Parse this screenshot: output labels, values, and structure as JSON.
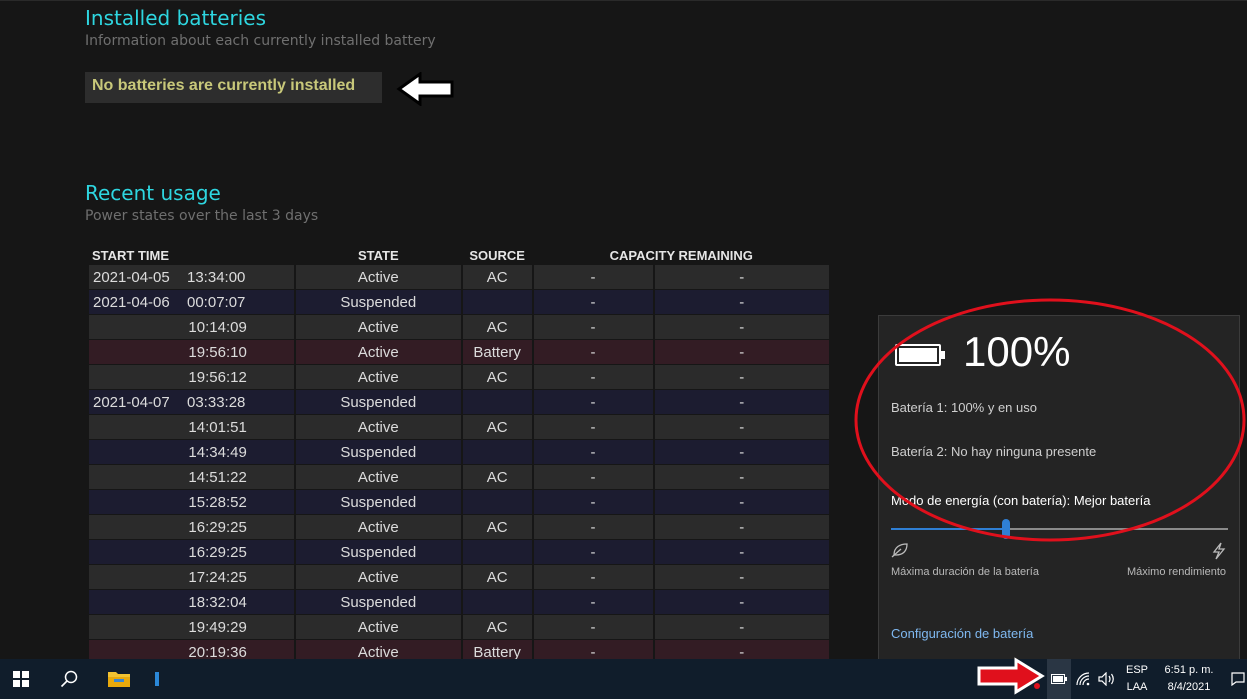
{
  "report": {
    "installed": {
      "title": "Installed batteries",
      "subtitle": "Information about each currently installed battery",
      "notice": "No batteries are currently installed"
    },
    "usage": {
      "title": "Recent usage",
      "subtitle": "Power states over the last 3 days",
      "columns": [
        "START TIME",
        "STATE",
        "SOURCE",
        "CAPACITY REMAINING"
      ],
      "rows": [
        {
          "date": "2021-04-05",
          "time": "13:34:00",
          "state": "Active",
          "source": "AC",
          "cap1": "-",
          "cap2": "-",
          "kind": "active"
        },
        {
          "date": "2021-04-06",
          "time": "00:07:07",
          "state": "Suspended",
          "source": "",
          "cap1": "-",
          "cap2": "-",
          "kind": "susp"
        },
        {
          "date": "",
          "time": "10:14:09",
          "state": "Active",
          "source": "AC",
          "cap1": "-",
          "cap2": "-",
          "kind": "active"
        },
        {
          "date": "",
          "time": "19:56:10",
          "state": "Active",
          "source": "Battery",
          "cap1": "-",
          "cap2": "-",
          "kind": "batt"
        },
        {
          "date": "",
          "time": "19:56:12",
          "state": "Active",
          "source": "AC",
          "cap1": "-",
          "cap2": "-",
          "kind": "active"
        },
        {
          "date": "2021-04-07",
          "time": "03:33:28",
          "state": "Suspended",
          "source": "",
          "cap1": "-",
          "cap2": "-",
          "kind": "susp"
        },
        {
          "date": "",
          "time": "14:01:51",
          "state": "Active",
          "source": "AC",
          "cap1": "-",
          "cap2": "-",
          "kind": "active"
        },
        {
          "date": "",
          "time": "14:34:49",
          "state": "Suspended",
          "source": "",
          "cap1": "-",
          "cap2": "-",
          "kind": "susp"
        },
        {
          "date": "",
          "time": "14:51:22",
          "state": "Active",
          "source": "AC",
          "cap1": "-",
          "cap2": "-",
          "kind": "active"
        },
        {
          "date": "",
          "time": "15:28:52",
          "state": "Suspended",
          "source": "",
          "cap1": "-",
          "cap2": "-",
          "kind": "susp"
        },
        {
          "date": "",
          "time": "16:29:25",
          "state": "Active",
          "source": "AC",
          "cap1": "-",
          "cap2": "-",
          "kind": "active"
        },
        {
          "date": "",
          "time": "16:29:25",
          "state": "Suspended",
          "source": "",
          "cap1": "-",
          "cap2": "-",
          "kind": "susp"
        },
        {
          "date": "",
          "time": "17:24:25",
          "state": "Active",
          "source": "AC",
          "cap1": "-",
          "cap2": "-",
          "kind": "active"
        },
        {
          "date": "",
          "time": "18:32:04",
          "state": "Suspended",
          "source": "",
          "cap1": "-",
          "cap2": "-",
          "kind": "susp"
        },
        {
          "date": "",
          "time": "19:49:29",
          "state": "Active",
          "source": "AC",
          "cap1": "-",
          "cap2": "-",
          "kind": "active"
        },
        {
          "date": "",
          "time": "20:19:36",
          "state": "Active",
          "source": "Battery",
          "cap1": "-",
          "cap2": "-",
          "kind": "batt"
        }
      ]
    }
  },
  "flyout": {
    "percent": "100%",
    "battery1": "Batería 1: 100% y en uso",
    "battery2": "Batería 2: No hay ninguna presente",
    "mode": "Modo de energía (con batería): Mejor batería",
    "slider_level": 0.34,
    "slider_left_label": "Máxima duración de la batería",
    "slider_right_label": "Máximo rendimiento",
    "link": "Configuración de batería"
  },
  "taskbar": {
    "language": "ESP",
    "layout": "LAA",
    "time": "6:51 p. m.",
    "date": "8/4/2021"
  },
  "colors": {
    "accent_heading": "#2ed6e0",
    "notice_text": "#c8c87a",
    "annotation": "#e0101c",
    "slider": "#2f7fd4",
    "taskbar": "#101d2b"
  },
  "icons": [
    "start-icon",
    "search-icon",
    "file-explorer-icon",
    "battery-tray-icon",
    "wifi-icon",
    "volume-icon",
    "notification-icon",
    "leaf-icon",
    "bolt-icon"
  ]
}
